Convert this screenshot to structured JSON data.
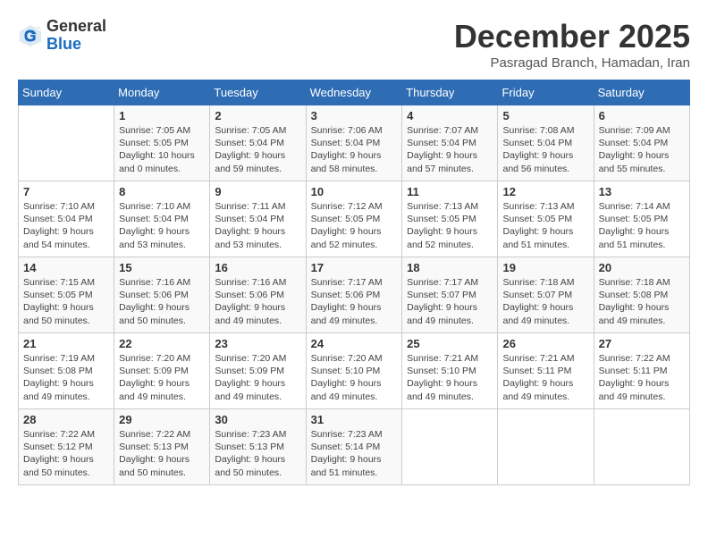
{
  "header": {
    "logo_general": "General",
    "logo_blue": "Blue",
    "month_title": "December 2025",
    "location": "Pasragad Branch, Hamadan, Iran"
  },
  "days_of_week": [
    "Sunday",
    "Monday",
    "Tuesday",
    "Wednesday",
    "Thursday",
    "Friday",
    "Saturday"
  ],
  "weeks": [
    [
      {
        "day": "",
        "info": ""
      },
      {
        "day": "1",
        "info": "Sunrise: 7:05 AM\nSunset: 5:05 PM\nDaylight: 10 hours\nand 0 minutes."
      },
      {
        "day": "2",
        "info": "Sunrise: 7:05 AM\nSunset: 5:04 PM\nDaylight: 9 hours\nand 59 minutes."
      },
      {
        "day": "3",
        "info": "Sunrise: 7:06 AM\nSunset: 5:04 PM\nDaylight: 9 hours\nand 58 minutes."
      },
      {
        "day": "4",
        "info": "Sunrise: 7:07 AM\nSunset: 5:04 PM\nDaylight: 9 hours\nand 57 minutes."
      },
      {
        "day": "5",
        "info": "Sunrise: 7:08 AM\nSunset: 5:04 PM\nDaylight: 9 hours\nand 56 minutes."
      },
      {
        "day": "6",
        "info": "Sunrise: 7:09 AM\nSunset: 5:04 PM\nDaylight: 9 hours\nand 55 minutes."
      }
    ],
    [
      {
        "day": "7",
        "info": "Sunrise: 7:10 AM\nSunset: 5:04 PM\nDaylight: 9 hours\nand 54 minutes."
      },
      {
        "day": "8",
        "info": "Sunrise: 7:10 AM\nSunset: 5:04 PM\nDaylight: 9 hours\nand 53 minutes."
      },
      {
        "day": "9",
        "info": "Sunrise: 7:11 AM\nSunset: 5:04 PM\nDaylight: 9 hours\nand 53 minutes."
      },
      {
        "day": "10",
        "info": "Sunrise: 7:12 AM\nSunset: 5:05 PM\nDaylight: 9 hours\nand 52 minutes."
      },
      {
        "day": "11",
        "info": "Sunrise: 7:13 AM\nSunset: 5:05 PM\nDaylight: 9 hours\nand 52 minutes."
      },
      {
        "day": "12",
        "info": "Sunrise: 7:13 AM\nSunset: 5:05 PM\nDaylight: 9 hours\nand 51 minutes."
      },
      {
        "day": "13",
        "info": "Sunrise: 7:14 AM\nSunset: 5:05 PM\nDaylight: 9 hours\nand 51 minutes."
      }
    ],
    [
      {
        "day": "14",
        "info": "Sunrise: 7:15 AM\nSunset: 5:05 PM\nDaylight: 9 hours\nand 50 minutes."
      },
      {
        "day": "15",
        "info": "Sunrise: 7:16 AM\nSunset: 5:06 PM\nDaylight: 9 hours\nand 50 minutes."
      },
      {
        "day": "16",
        "info": "Sunrise: 7:16 AM\nSunset: 5:06 PM\nDaylight: 9 hours\nand 49 minutes."
      },
      {
        "day": "17",
        "info": "Sunrise: 7:17 AM\nSunset: 5:06 PM\nDaylight: 9 hours\nand 49 minutes."
      },
      {
        "day": "18",
        "info": "Sunrise: 7:17 AM\nSunset: 5:07 PM\nDaylight: 9 hours\nand 49 minutes."
      },
      {
        "day": "19",
        "info": "Sunrise: 7:18 AM\nSunset: 5:07 PM\nDaylight: 9 hours\nand 49 minutes."
      },
      {
        "day": "20",
        "info": "Sunrise: 7:18 AM\nSunset: 5:08 PM\nDaylight: 9 hours\nand 49 minutes."
      }
    ],
    [
      {
        "day": "21",
        "info": "Sunrise: 7:19 AM\nSunset: 5:08 PM\nDaylight: 9 hours\nand 49 minutes."
      },
      {
        "day": "22",
        "info": "Sunrise: 7:20 AM\nSunset: 5:09 PM\nDaylight: 9 hours\nand 49 minutes."
      },
      {
        "day": "23",
        "info": "Sunrise: 7:20 AM\nSunset: 5:09 PM\nDaylight: 9 hours\nand 49 minutes."
      },
      {
        "day": "24",
        "info": "Sunrise: 7:20 AM\nSunset: 5:10 PM\nDaylight: 9 hours\nand 49 minutes."
      },
      {
        "day": "25",
        "info": "Sunrise: 7:21 AM\nSunset: 5:10 PM\nDaylight: 9 hours\nand 49 minutes."
      },
      {
        "day": "26",
        "info": "Sunrise: 7:21 AM\nSunset: 5:11 PM\nDaylight: 9 hours\nand 49 minutes."
      },
      {
        "day": "27",
        "info": "Sunrise: 7:22 AM\nSunset: 5:11 PM\nDaylight: 9 hours\nand 49 minutes."
      }
    ],
    [
      {
        "day": "28",
        "info": "Sunrise: 7:22 AM\nSunset: 5:12 PM\nDaylight: 9 hours\nand 50 minutes."
      },
      {
        "day": "29",
        "info": "Sunrise: 7:22 AM\nSunset: 5:13 PM\nDaylight: 9 hours\nand 50 minutes."
      },
      {
        "day": "30",
        "info": "Sunrise: 7:23 AM\nSunset: 5:13 PM\nDaylight: 9 hours\nand 50 minutes."
      },
      {
        "day": "31",
        "info": "Sunrise: 7:23 AM\nSunset: 5:14 PM\nDaylight: 9 hours\nand 51 minutes."
      },
      {
        "day": "",
        "info": ""
      },
      {
        "day": "",
        "info": ""
      },
      {
        "day": "",
        "info": ""
      }
    ]
  ]
}
